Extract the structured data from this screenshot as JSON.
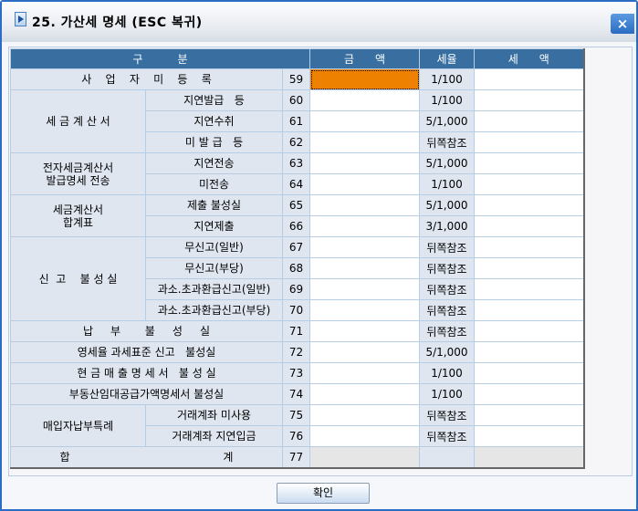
{
  "title": "25. 가산세 명세 (ESC 복귀)",
  "close_label": "×",
  "headers": {
    "category": "구          분",
    "amount": "금      액",
    "rate": "세율",
    "tax": "세      액"
  },
  "rows": [
    {
      "group": "사    업    자    미    등    록",
      "span": 1,
      "full": true,
      "code": "59",
      "rate": "1/100",
      "selected": true
    },
    {
      "group": "세 금 계 산 서",
      "span": 3,
      "sub": "지연발급   등",
      "code": "60",
      "rate": "1/100"
    },
    {
      "sub": "지연수취",
      "code": "61",
      "rate": "5/1,000"
    },
    {
      "sub": "미 발 급   등",
      "code": "62",
      "rate": "뒤쪽참조"
    },
    {
      "group": "전자세금계산서\n발급명세 전송",
      "span": 2,
      "sub": "지연전송",
      "code": "63",
      "rate": "5/1,000"
    },
    {
      "sub": "미전송",
      "code": "64",
      "rate": "1/100"
    },
    {
      "group": "세금계산서\n합계표",
      "span": 2,
      "sub": "제출 불성실",
      "code": "65",
      "rate": "5/1,000"
    },
    {
      "sub": "지연제출",
      "code": "66",
      "rate": "3/1,000"
    },
    {
      "group": "신  고    불 성 실",
      "span": 4,
      "sub": "무신고(일반)",
      "code": "67",
      "rate": "뒤쪽참조"
    },
    {
      "sub": "무신고(부당)",
      "code": "68",
      "rate": "뒤쪽참조"
    },
    {
      "sub": "과소.초과환급신고(일반)",
      "code": "69",
      "rate": "뒤쪽참조"
    },
    {
      "sub": "과소.초과환급신고(부당)",
      "code": "70",
      "rate": "뒤쪽참조"
    },
    {
      "group": "납     부       불     성     실",
      "span": 1,
      "full": true,
      "code": "71",
      "rate": "뒤쪽참조"
    },
    {
      "group": "영세율 과세표준 신고   불성실",
      "span": 1,
      "full": true,
      "code": "72",
      "rate": "5/1,000"
    },
    {
      "group": "현 금 매 출 명 세 서   불 성 실",
      "span": 1,
      "full": true,
      "code": "73",
      "rate": "1/100"
    },
    {
      "group": "부동산임대공급가액명세서 불성실",
      "span": 1,
      "full": true,
      "code": "74",
      "rate": "1/100"
    },
    {
      "group": "매입자납부특례",
      "span": 2,
      "sub": "거래계좌 미사용",
      "code": "75",
      "rate": "뒤쪽참조"
    },
    {
      "sub": "거래계좌 지연입금",
      "code": "76",
      "rate": "뒤쪽참조"
    },
    {
      "group": "합                                            계",
      "span": 1,
      "full": true,
      "code": "77",
      "rate": "",
      "total": true
    }
  ],
  "ok_label": "확인"
}
